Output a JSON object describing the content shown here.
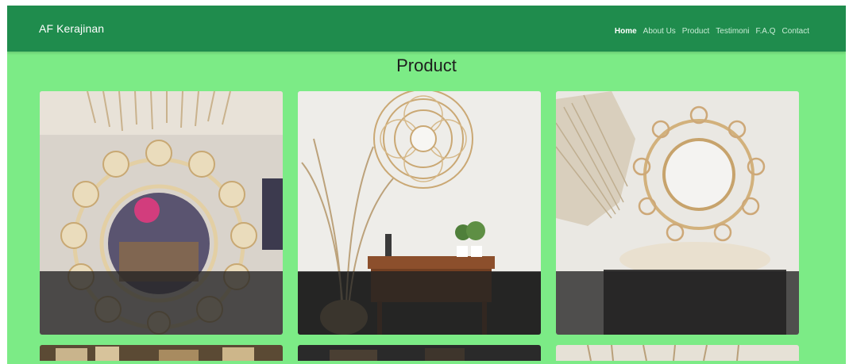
{
  "navbar": {
    "brand": "AF Kerajinan",
    "links": [
      {
        "label": "Home",
        "active": true
      },
      {
        "label": "About Us",
        "active": false
      },
      {
        "label": "Product",
        "active": false
      },
      {
        "label": "Testimoni",
        "active": false
      },
      {
        "label": "F.A.Q",
        "active": false
      },
      {
        "label": "Contact",
        "active": false
      }
    ]
  },
  "section": {
    "title": "Product"
  },
  "colors": {
    "page_background": "#7ceb86",
    "navbar": "#1f8c4d",
    "card_overlay": "#222222"
  },
  "products": [
    {
      "image": "rattan-flower-mirror-1"
    },
    {
      "image": "rattan-round-mirror-with-console"
    },
    {
      "image": "rattan-flower-mirror-2"
    },
    {
      "image": "rattan-items-shelf"
    },
    {
      "image": "dark-shelf-products"
    },
    {
      "image": "dried-grass-decor"
    }
  ]
}
